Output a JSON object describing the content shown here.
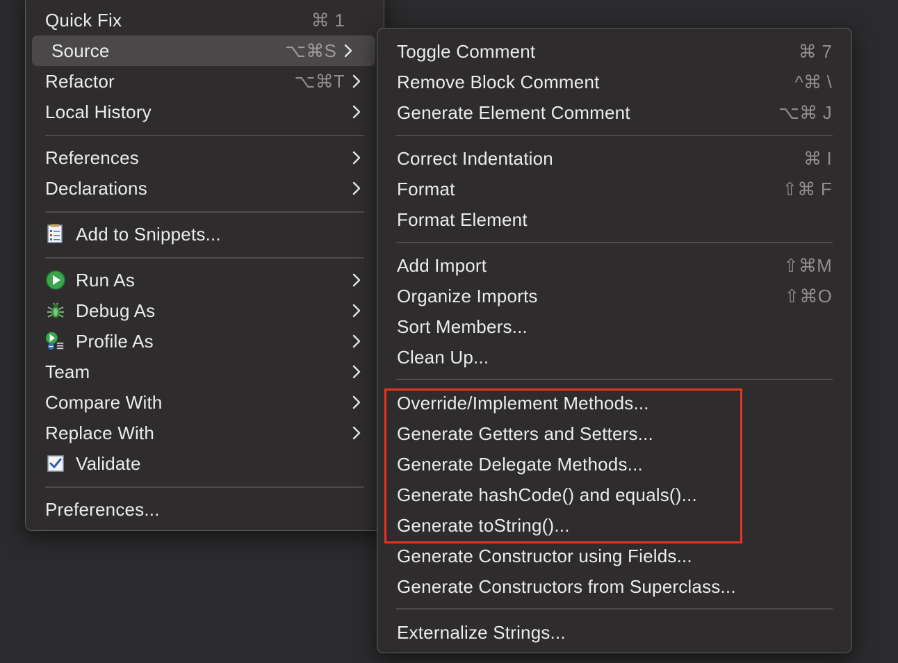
{
  "main_menu": {
    "items": [
      {
        "label": "Quick Fix",
        "shortcut": "⌘ 1"
      },
      {
        "label": "Source",
        "shortcut": "⌥⌘S"
      },
      {
        "label": "Refactor",
        "shortcut": "⌥⌘T"
      },
      {
        "label": "Local History"
      },
      {
        "label": "References"
      },
      {
        "label": "Declarations"
      },
      {
        "label": "Add to Snippets...",
        "icon": "snippets-icon"
      },
      {
        "label": "Run As",
        "icon": "run-icon"
      },
      {
        "label": "Debug As",
        "icon": "debug-icon"
      },
      {
        "label": "Profile As",
        "icon": "profile-icon"
      },
      {
        "label": "Team"
      },
      {
        "label": "Compare With"
      },
      {
        "label": "Replace With"
      },
      {
        "label": "Validate",
        "icon": "checkbox-icon"
      },
      {
        "label": "Preferences..."
      }
    ],
    "selected": "Source"
  },
  "sub_menu": {
    "items": [
      {
        "label": "Toggle Comment",
        "shortcut": "⌘ 7"
      },
      {
        "label": "Remove Block Comment",
        "shortcut": "^⌘ \\"
      },
      {
        "label": "Generate Element Comment",
        "shortcut": "⌥⌘ J"
      },
      {
        "label": "Correct Indentation",
        "shortcut": "⌘ I"
      },
      {
        "label": "Format",
        "shortcut": "⇧⌘ F"
      },
      {
        "label": "Format Element"
      },
      {
        "label": "Add Import",
        "shortcut": "⇧⌘M"
      },
      {
        "label": "Organize Imports",
        "shortcut": "⇧⌘O"
      },
      {
        "label": "Sort Members..."
      },
      {
        "label": "Clean Up..."
      },
      {
        "label": "Override/Implement Methods..."
      },
      {
        "label": "Generate Getters and Setters..."
      },
      {
        "label": "Generate Delegate Methods..."
      },
      {
        "label": "Generate hashCode() and equals()..."
      },
      {
        "label": "Generate toString()..."
      },
      {
        "label": "Generate Constructor using Fields..."
      },
      {
        "label": "Generate Constructors from Superclass..."
      },
      {
        "label": "Externalize Strings..."
      }
    ]
  },
  "colors": {
    "background": "#2b2b2d",
    "menu": "#2e2c2d",
    "selected": "#4a4849",
    "highlight_box": "#e8331f"
  }
}
